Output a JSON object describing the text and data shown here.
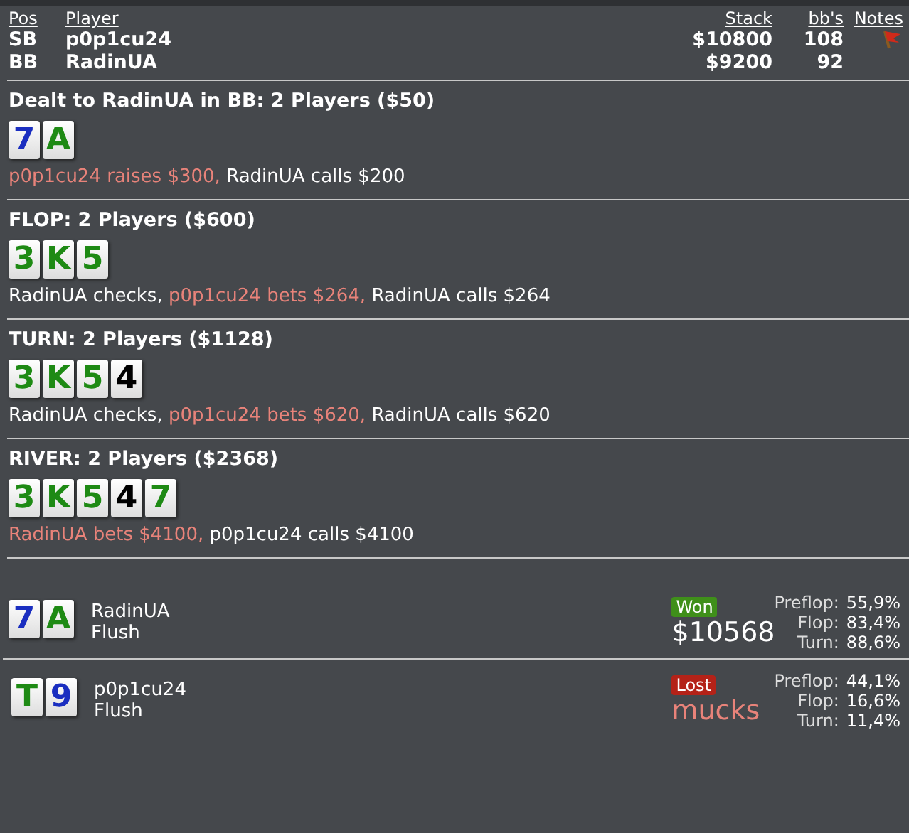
{
  "players_table": {
    "columns": [
      "Pos",
      "Player",
      "Stack",
      "bb's",
      "Notes"
    ],
    "rows": [
      {
        "pos": "SB",
        "player": "p0p1cu24",
        "stack": "$10800",
        "bbs": "108",
        "has_note": true
      },
      {
        "pos": "BB",
        "player": "RadinUA",
        "stack": "$9200",
        "bbs": "92",
        "has_note": false
      }
    ]
  },
  "streets": [
    {
      "title": "Dealt to RadinUA in BB: 2 Players ($50)",
      "cards": [
        {
          "rank": "7",
          "color": "#1a2ec0"
        },
        {
          "rank": "A",
          "color": "#1e8a14"
        }
      ],
      "actions": [
        {
          "text": "p0p1cu24 raises $300,",
          "kind": "aggressive"
        },
        {
          "text": "RadinUA calls $200",
          "kind": "passive"
        }
      ]
    },
    {
      "title": "FLOP: 2 Players ($600)",
      "cards": [
        {
          "rank": "3",
          "color": "#1e8a14"
        },
        {
          "rank": "K",
          "color": "#1e8a14"
        },
        {
          "rank": "5",
          "color": "#1e8a14"
        }
      ],
      "actions": [
        {
          "text": "RadinUA checks,",
          "kind": "passive"
        },
        {
          "text": "p0p1cu24 bets $264,",
          "kind": "aggressive"
        },
        {
          "text": "RadinUA calls $264",
          "kind": "passive"
        }
      ]
    },
    {
      "title": "TURN: 2 Players ($1128)",
      "cards": [
        {
          "rank": "3",
          "color": "#1e8a14"
        },
        {
          "rank": "K",
          "color": "#1e8a14"
        },
        {
          "rank": "5",
          "color": "#1e8a14"
        },
        {
          "rank": "4",
          "color": "#000000"
        }
      ],
      "actions": [
        {
          "text": "RadinUA checks,",
          "kind": "passive"
        },
        {
          "text": "p0p1cu24 bets $620,",
          "kind": "aggressive"
        },
        {
          "text": "RadinUA calls $620",
          "kind": "passive"
        }
      ]
    },
    {
      "title": "RIVER: 2 Players ($2368)",
      "cards": [
        {
          "rank": "3",
          "color": "#1e8a14"
        },
        {
          "rank": "K",
          "color": "#1e8a14"
        },
        {
          "rank": "5",
          "color": "#1e8a14"
        },
        {
          "rank": "4",
          "color": "#000000"
        },
        {
          "rank": "7",
          "color": "#1e8a14"
        }
      ],
      "actions": [
        {
          "text": "RadinUA bets $4100,",
          "kind": "aggressive"
        },
        {
          "text": "p0p1cu24 calls $4100",
          "kind": "passive"
        }
      ]
    }
  ],
  "results": [
    {
      "cards": [
        {
          "rank": "7",
          "color": "#1a2ec0"
        },
        {
          "rank": "A",
          "color": "#1e8a14"
        }
      ],
      "player": "RadinUA",
      "hand": "Flush",
      "won": true,
      "badge": "Won",
      "amount": "$10568",
      "equity": [
        {
          "label": "Preflop:",
          "value": "55,9%"
        },
        {
          "label": "Flop:",
          "value": "83,4%"
        },
        {
          "label": "Turn:",
          "value": "88,6%"
        }
      ]
    },
    {
      "cards": [
        {
          "rank": "T",
          "color": "#1e8a14"
        },
        {
          "rank": "9",
          "color": "#1a2ec0"
        }
      ],
      "player": "p0p1cu24",
      "hand": "Flush",
      "won": false,
      "badge": "Lost",
      "amount": "mucks",
      "equity": [
        {
          "label": "Preflop:",
          "value": "44,1%"
        },
        {
          "label": "Flop:",
          "value": "16,6%"
        },
        {
          "label": "Turn:",
          "value": "11,4%"
        }
      ]
    }
  ]
}
